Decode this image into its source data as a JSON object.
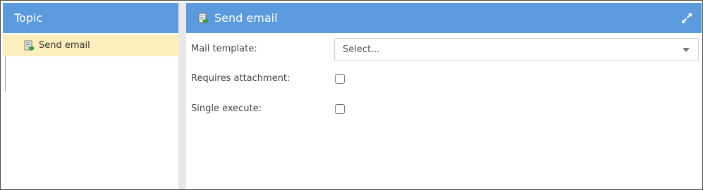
{
  "left_panel": {
    "title": "Topic",
    "items": [
      {
        "label": "Send email",
        "icon": "send-email-icon",
        "selected": true
      }
    ]
  },
  "right_panel": {
    "title": "Send email",
    "title_icon": "send-email-icon",
    "expand_icon": "expand-icon"
  },
  "form": {
    "mail_template_label": "Mail template:",
    "mail_template_value": "Select...",
    "requires_attachment_label": "Requires attachment:",
    "requires_attachment_checked": false,
    "single_execute_label": "Single execute:",
    "single_execute_checked": false
  },
  "colors": {
    "header": "#5b9bdd",
    "selected_row": "#fdefbd",
    "splitter": "#e8e8e8"
  }
}
